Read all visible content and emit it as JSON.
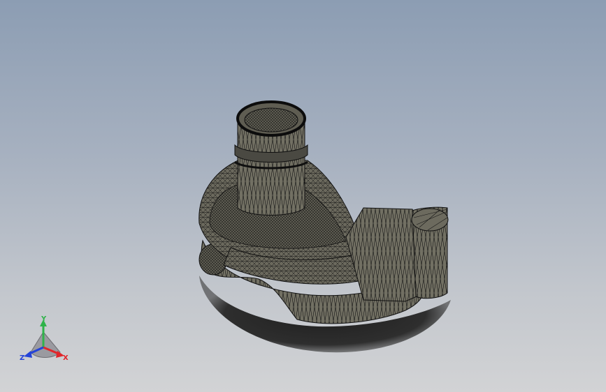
{
  "viewport": {
    "background_top": "#8c9db3",
    "background_bottom": "#d2d3d5"
  },
  "model": {
    "render_mode": "shaded-with-edges",
    "body_color": "#6f6d60",
    "edge_color": "#141414",
    "shadow_color": "#2a2a2a"
  },
  "triad": {
    "x_label": "X",
    "y_label": "Y",
    "z_label": "Z",
    "x_color": "#e0262b",
    "y_color": "#2fb34a",
    "z_color": "#2443d8"
  }
}
